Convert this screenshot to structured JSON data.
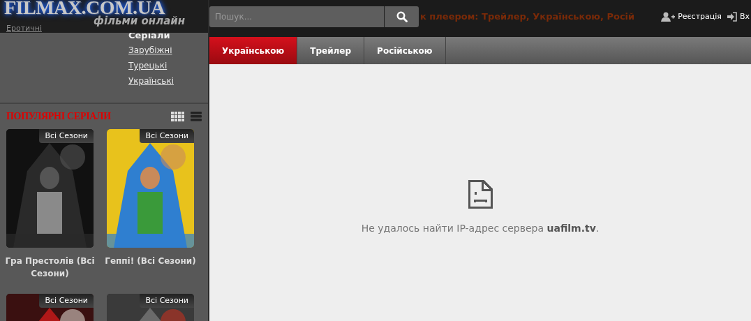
{
  "logo": {
    "title": "FILMAX.COM.UA",
    "tagline": "фільми онлайн"
  },
  "genre_link": "Еротичні",
  "series_menu": {
    "heading": "Серіали",
    "links": [
      "Зарубіжні",
      "Турецькі",
      "Українські"
    ]
  },
  "popular": {
    "heading": "ПОПУЛЯРНІ СЕРІАЛИ",
    "items": [
      {
        "badge": "Всі Сезони",
        "title": "Гра Престолів (Всі Сезони)",
        "kind": "picture"
      },
      {
        "badge": "Всі Сезони",
        "title": "Геппі! (Всі Сезони)",
        "kind": "picture"
      },
      {
        "badge": "Всі Сезони",
        "kind": "picture"
      },
      {
        "badge": "Всі Сезони",
        "kind": "picture"
      }
    ]
  },
  "search": {
    "placeholder": "Пошук..."
  },
  "page_title": "к плеером: Трейлер, Українською, Росій",
  "user_links": [
    {
      "label": "Реєстрація",
      "kind": "register"
    },
    {
      "label": "Вх",
      "kind": "login"
    }
  ],
  "tabs": [
    {
      "label": "Українською",
      "selected": true
    },
    {
      "label": "Трейлер",
      "selected": false
    },
    {
      "label": "Російською",
      "selected": false
    }
  ],
  "error": {
    "message": "Не удалось найти IP-адрес сервера **uafilm.tv**."
  }
}
